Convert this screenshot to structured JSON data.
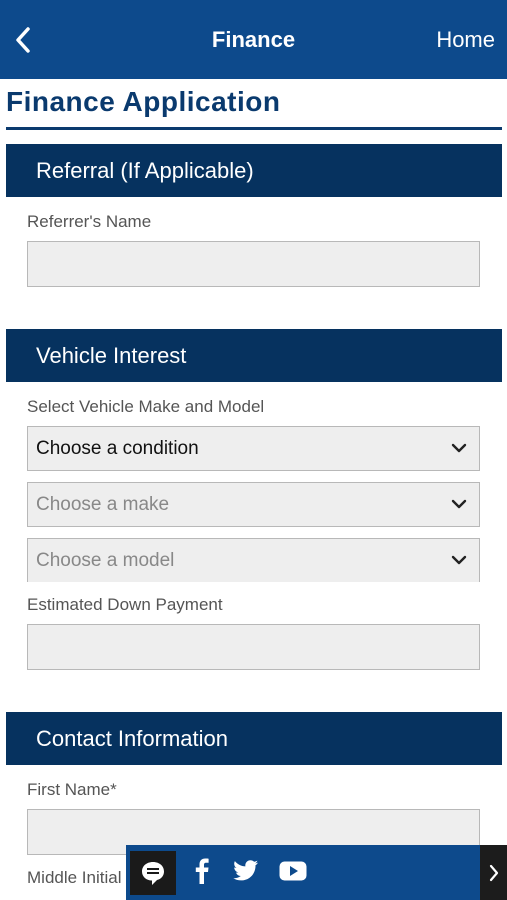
{
  "topbar": {
    "title": "Finance",
    "home_label": "Home"
  },
  "page": {
    "title": "Finance Application"
  },
  "sections": {
    "referral": {
      "header": "Referral (If Applicable)",
      "referrer_label": "Referrer's Name",
      "referrer_value": ""
    },
    "vehicle": {
      "header": "Vehicle Interest",
      "select_label": "Select Vehicle Make and Model",
      "condition_value": "Choose a condition",
      "make_value": "Choose a make",
      "model_value": "Choose a model",
      "down_payment_label": "Estimated Down Payment",
      "down_payment_value": ""
    },
    "contact": {
      "header": "Contact Information",
      "first_name_label": "First Name*",
      "middle_initial_label": "Middle Initial"
    }
  },
  "icons": {
    "back": "chevron-left-icon",
    "chat": "chat-icon",
    "facebook": "facebook-icon",
    "twitter": "twitter-icon",
    "youtube": "youtube-icon",
    "expand": "chevron-right-icon"
  },
  "colors": {
    "header_blue": "#0d4a8c",
    "section_navy": "#06325f",
    "title_navy": "#0a3a6e"
  }
}
